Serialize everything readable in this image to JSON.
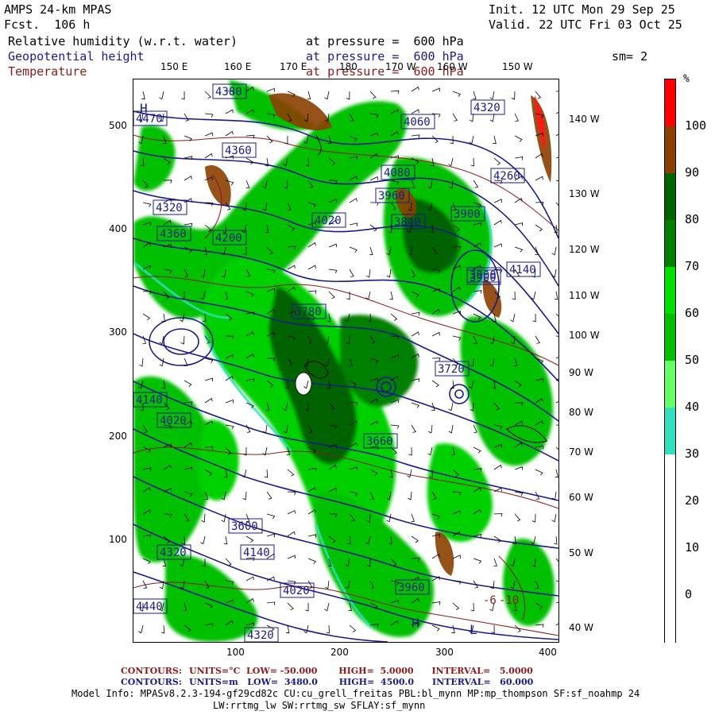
{
  "header": {
    "model": "AMPS 24-km MPAS",
    "forecast": "Fcst.  106 h",
    "init": "Init. 12 UTC Mon 29 Sep 25",
    "valid": "Valid. 22 UTC Fri 03 Oct 25",
    "smoothing": "sm= 2"
  },
  "fields": [
    {
      "name": "Relative humidity (w.r.t. water)",
      "level": "at pressure =  600 hPa",
      "color": "#000000"
    },
    {
      "name": "Geopotential height",
      "level": "at pressure =  600 hPa",
      "color": "#1a1a8c"
    },
    {
      "name": "Temperature",
      "level": "at pressure =  600 hPa",
      "color": "#8b1a1a"
    }
  ],
  "colorbar": {
    "unit": "%",
    "levels": [
      {
        "label": "100",
        "color": "#ff0000"
      },
      {
        "label": "90",
        "color": "#8b4000"
      },
      {
        "label": "80",
        "color": "#006400"
      },
      {
        "label": "70",
        "color": "#008000"
      },
      {
        "label": "60",
        "color": "#00e000"
      },
      {
        "label": "50",
        "color": "#00c000"
      },
      {
        "label": "40",
        "color": "#66ff66"
      },
      {
        "label": "30",
        "color": "#30e0c0"
      },
      {
        "label": "20",
        "color": "#ffffff"
      },
      {
        "label": "10",
        "color": "#ffffff"
      },
      {
        "label": "0",
        "color": "#ffffff"
      }
    ],
    "labels_shown": [
      "100",
      "90",
      "80",
      "70",
      "60",
      "50",
      "40",
      "30",
      "20",
      "10",
      "0"
    ]
  },
  "axes": {
    "x_ticks": [
      "100",
      "200",
      "300",
      "400"
    ],
    "y_ticks": [
      "500",
      "400",
      "300",
      "200",
      "100"
    ],
    "top_lon": [
      "150 E",
      "160 E",
      "170 E",
      "180",
      "170 W",
      "160 W",
      "150 W"
    ],
    "right_lon": [
      "140 W",
      "130 W",
      "120 W",
      "110 W",
      "100 W",
      "90 W",
      "80 W",
      "70 W",
      "60 W",
      "50 W",
      "40 W"
    ]
  },
  "contour_labels": [
    "4380",
    "4470",
    "4360",
    "4320",
    "4200",
    "4080",
    "4060",
    "3960",
    "4020",
    "3840",
    "3780",
    "3900",
    "4140",
    "4260",
    "3720",
    "3660",
    "3600",
    "4440"
  ],
  "temp_labels": [
    "-6",
    "-10"
  ],
  "pressure_marks": [
    "H",
    "L"
  ],
  "footer": {
    "line1_label": "CONTOURS:",
    "line1": "UNITS=°C  LOW= -50.000       HIGH=  5.0000      INTERVAL=   5.0000",
    "line2_label": "CONTOURS:",
    "line2": "UNITS=m   LOW=  3480.0       HIGH=  4500.0      INTERVAL=   60.000",
    "model_info": "Model Info: MPASv8.2.3-194-gf29cd82c CU:cu_grell_freitas PBL:bl_mynn MP:mp_thompson SF:sf_noahmp 24",
    "model_info2": "LW:rrtmg_lw SW:rrtmg_sw SFLAY:sf_mynn"
  }
}
